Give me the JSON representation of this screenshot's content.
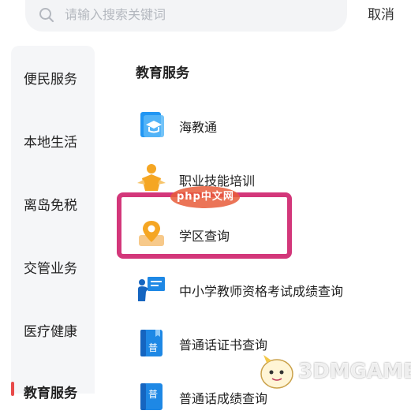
{
  "search": {
    "placeholder": "请输入搜索关键词",
    "cancel_label": "取消"
  },
  "sidebar": {
    "items": [
      {
        "label": "便民服务",
        "active": false
      },
      {
        "label": "本地生活",
        "active": false
      },
      {
        "label": "离岛免税",
        "active": false
      },
      {
        "label": "交管业务",
        "active": false
      },
      {
        "label": "医疗健康",
        "active": false
      },
      {
        "label": "教育服务",
        "active": true
      }
    ]
  },
  "main": {
    "section_title": "教育服务",
    "services": [
      {
        "label": "海教通",
        "icon": "cap-card-icon"
      },
      {
        "label": "职业技能培训",
        "icon": "trainer-icon"
      },
      {
        "label": "学区查询",
        "icon": "location-pin-icon"
      },
      {
        "label": "中小学教师资格考试成绩查询",
        "icon": "teacher-board-icon"
      },
      {
        "label": "普通话证书查询",
        "icon": "certificate-icon"
      },
      {
        "label": "普通话成绩查询",
        "icon": "certificate-icon"
      }
    ]
  },
  "watermarks": {
    "php": "php中文网",
    "game": "3DMGAME"
  },
  "colors": {
    "accent_red": "#e84a4a",
    "highlight": "#d3377a",
    "icon_blue": "#1e88e5",
    "icon_orange": "#f5a623"
  }
}
